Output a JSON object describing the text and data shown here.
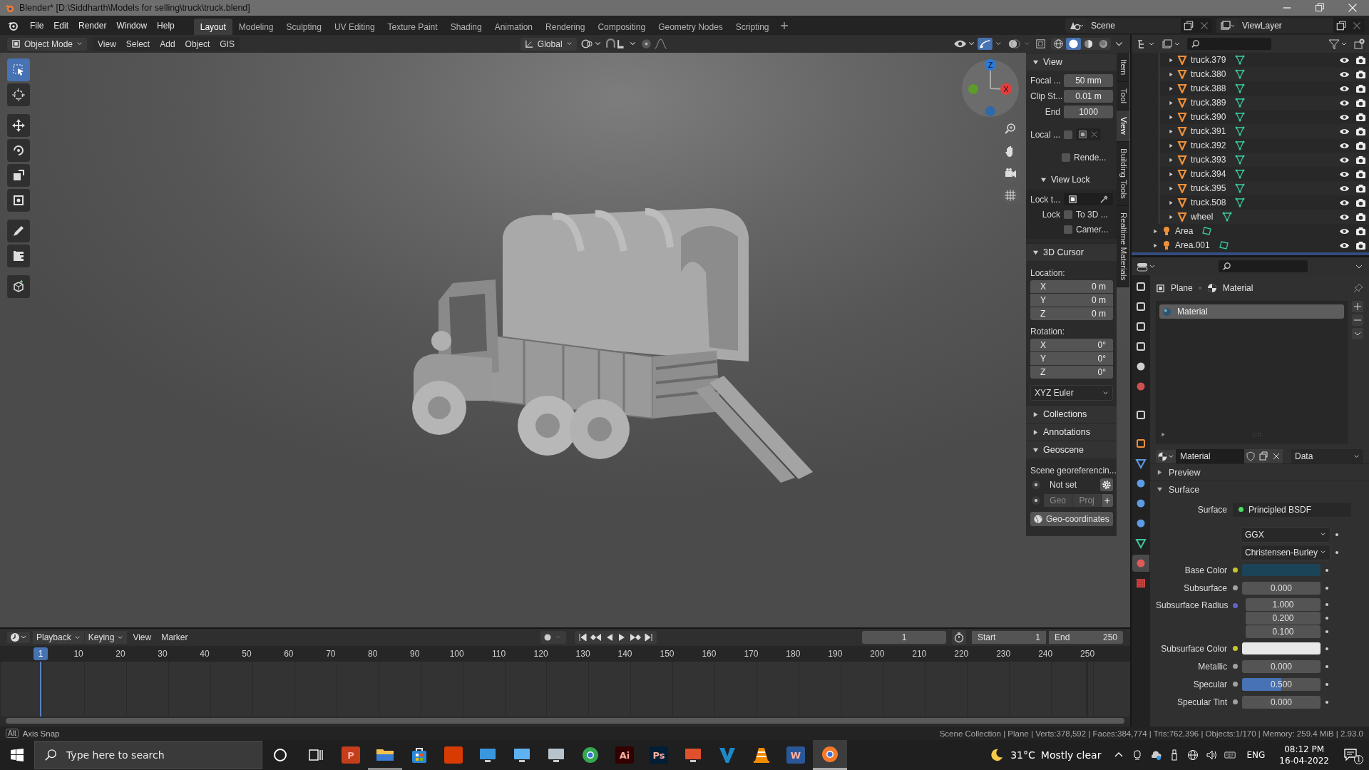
{
  "window": {
    "title": "Blender* [D:\\Siddharth\\Models for selling\\truck\\truck.blend]"
  },
  "menu": [
    "File",
    "Edit",
    "Render",
    "Window",
    "Help"
  ],
  "workspaces": [
    {
      "label": "Layout",
      "selected": true
    },
    {
      "label": "Modeling",
      "selected": false
    },
    {
      "label": "Sculpting",
      "selected": false
    },
    {
      "label": "UV Editing",
      "selected": false
    },
    {
      "label": "Texture Paint",
      "selected": false
    },
    {
      "label": "Shading",
      "selected": false
    },
    {
      "label": "Animation",
      "selected": false
    },
    {
      "label": "Rendering",
      "selected": false
    },
    {
      "label": "Compositing",
      "selected": false
    },
    {
      "label": "Geometry Nodes",
      "selected": false
    },
    {
      "label": "Scripting",
      "selected": false
    }
  ],
  "scene": "Scene",
  "view_layer": "ViewLayer",
  "viewport_header": {
    "mode": "Object Mode",
    "menus": [
      "View",
      "Select",
      "Add",
      "Object",
      "GIS"
    ],
    "orientation": "Global",
    "shading": [
      {
        "kind": "wireframe",
        "selected": false
      },
      {
        "kind": "solid",
        "selected": true
      },
      {
        "kind": "material",
        "selected": false
      },
      {
        "kind": "rendered",
        "selected": false
      }
    ]
  },
  "tools": [
    {
      "kind": "select",
      "selected": true
    },
    {
      "kind": "cursor",
      "selected": false
    },
    {
      "kind": "move",
      "selected": false
    },
    {
      "kind": "rotate",
      "selected": false
    },
    {
      "kind": "scale",
      "selected": false
    },
    {
      "kind": "transform",
      "selected": false
    },
    {
      "kind": "annotate",
      "selected": false
    },
    {
      "kind": "measure",
      "selected": false
    },
    {
      "kind": "add-cube",
      "selected": false
    }
  ],
  "gizmo": {
    "z": "Z",
    "x": "X"
  },
  "sidebar": {
    "tabs": [
      {
        "label": "Item",
        "selected": false
      },
      {
        "label": "Tool",
        "selected": false
      },
      {
        "label": "View",
        "selected": true
      },
      {
        "label": "Building Tools",
        "selected": false
      },
      {
        "label": "Realtime Materials",
        "selected": false
      }
    ],
    "view": {
      "title": "View",
      "expanded": true,
      "fields": [
        {
          "label": "Focal ...",
          "value": "50 mm"
        },
        {
          "label": "Clip St...",
          "value": "0.01 m"
        },
        {
          "label": "End",
          "value": "1000"
        }
      ],
      "local_label": "Local ...",
      "local_checked": false,
      "render_label": "Rende...",
      "render_checked": false,
      "lock": {
        "title": "View Lock",
        "expanded": true,
        "lock_to_label": "Lock t...",
        "lock_label": "Lock",
        "options": [
          {
            "label": "To 3D ...",
            "checked": false
          },
          {
            "label": "Camer...",
            "checked": false
          }
        ]
      }
    },
    "cursor": {
      "title": "3D Cursor",
      "expanded": true,
      "location_label": "Location:",
      "location": [
        {
          "axis": "X",
          "value": "0 m"
        },
        {
          "axis": "Y",
          "value": "0 m"
        },
        {
          "axis": "Z",
          "value": "0 m"
        }
      ],
      "rotation_label": "Rotation:",
      "rotation": [
        {
          "axis": "X",
          "value": "0°"
        },
        {
          "axis": "Y",
          "value": "0°"
        },
        {
          "axis": "Z",
          "value": "0°"
        }
      ],
      "rotation_mode": "XYZ Euler"
    },
    "panels": [
      {
        "title": "Collections",
        "expanded": false
      },
      {
        "title": "Annotations",
        "expanded": false
      }
    ],
    "geoscene": {
      "title": "Geoscene",
      "expanded": true,
      "label": "Scene georeferencin...",
      "crs": "Not set",
      "crs_selected": true,
      "geoproj_selected": true,
      "geo": "Geo",
      "proj": "Proj",
      "add": "+",
      "button": "Geo-coordinates"
    }
  },
  "outliner": {
    "items": [
      {
        "children": [
          {
            "name": "truck.379",
            "kind": "mesh",
            "expanded": false,
            "selected": false
          },
          {
            "name": "truck.380",
            "kind": "mesh",
            "expanded": false,
            "selected": false
          },
          {
            "name": "truck.388",
            "kind": "mesh",
            "expanded": false,
            "selected": false
          },
          {
            "name": "truck.389",
            "kind": "mesh",
            "expanded": false,
            "selected": false
          },
          {
            "name": "truck.390",
            "kind": "mesh",
            "expanded": false,
            "selected": false
          },
          {
            "name": "truck.391",
            "kind": "mesh",
            "expanded": false,
            "selected": false
          },
          {
            "name": "truck.392",
            "kind": "mesh",
            "expanded": false,
            "selected": false
          },
          {
            "name": "truck.393",
            "kind": "mesh",
            "expanded": false,
            "selected": false
          },
          {
            "name": "truck.394",
            "kind": "mesh",
            "expanded": false,
            "selected": false
          },
          {
            "name": "truck.395",
            "kind": "mesh",
            "expanded": false,
            "selected": false
          },
          {
            "name": "truck.508",
            "kind": "mesh",
            "expanded": false,
            "selected": false
          },
          {
            "name": "wheel",
            "kind": "mesh",
            "expanded": false,
            "selected": false
          }
        ]
      },
      {
        "name": "Area",
        "kind": "light",
        "expanded": false,
        "selected": false
      },
      {
        "name": "Area.001",
        "kind": "light",
        "expanded": false,
        "selected": false
      },
      {
        "selected": true
      }
    ]
  },
  "properties": {
    "tabs": [
      {
        "kind": "tool",
        "selected": false
      },
      {
        "kind": "render",
        "selected": false
      },
      {
        "kind": "output",
        "selected": false
      },
      {
        "kind": "view-layer",
        "selected": false
      },
      {
        "kind": "scene",
        "selected": false
      },
      {
        "kind": "world",
        "selected": false
      },
      {
        "kind": "collection",
        "selected": false
      },
      {
        "kind": "object",
        "selected": false
      },
      {
        "kind": "modifier",
        "selected": false
      },
      {
        "kind": "particles",
        "selected": false
      },
      {
        "kind": "physics",
        "selected": false
      },
      {
        "kind": "constraints",
        "selected": false
      },
      {
        "kind": "data",
        "selected": false
      },
      {
        "kind": "material",
        "selected": true
      },
      {
        "kind": "texture",
        "selected": false
      }
    ],
    "breadcrumb": [
      "Plane",
      "Material"
    ],
    "slots": [
      {
        "name": "Material",
        "selected": true
      }
    ],
    "material": "Material",
    "link": "Data",
    "panels": [
      {
        "title": "Preview",
        "expanded": false
      },
      {
        "title": "Surface",
        "expanded": true
      }
    ],
    "surface": {
      "label": "Surface",
      "value": "Principled BSDF"
    },
    "distribution": "GGX",
    "subsurface_method": "Christensen-Burley",
    "rows": [
      {
        "kind": "color",
        "label": "Base Color",
        "color": "#1b4458"
      },
      {
        "kind": "number",
        "label": "Subsurface",
        "value": "0.000"
      },
      {
        "kind": "vector",
        "label": "Subsurface Radius",
        "values": [
          "1.000",
          "0.200",
          "0.100"
        ]
      },
      {
        "kind": "color",
        "label": "Subsurface Color",
        "color": "#e8e8e8"
      },
      {
        "kind": "number",
        "label": "Metallic",
        "value": "0.000"
      },
      {
        "kind": "slider",
        "label": "Specular",
        "value": "0.500",
        "level": 0.5
      },
      {
        "kind": "number",
        "label": "Specular Tint",
        "value": "0.000"
      }
    ]
  },
  "timeline": {
    "menus": [
      {
        "label": "Playback",
        "kind": "dropdown"
      },
      {
        "label": "Keying",
        "kind": "dropdown"
      },
      {
        "label": "View",
        "kind": "menu"
      },
      {
        "label": "Marker",
        "kind": "menu"
      }
    ],
    "current": "1",
    "start_label": "Start",
    "start": "1",
    "end_label": "End",
    "end": "250",
    "ruler": [
      {
        "label": "1",
        "selected": true
      },
      {
        "label": "10",
        "selected": false
      },
      {
        "label": "20",
        "selected": false
      },
      {
        "label": "30",
        "selected": false
      },
      {
        "label": "40",
        "selected": false
      },
      {
        "label": "50",
        "selected": false
      },
      {
        "label": "60",
        "selected": false
      },
      {
        "label": "70",
        "selected": false
      },
      {
        "label": "80",
        "selected": false
      },
      {
        "label": "90",
        "selected": false
      },
      {
        "label": "100",
        "selected": false
      },
      {
        "label": "110",
        "selected": false
      },
      {
        "label": "120",
        "selected": false
      },
      {
        "label": "130",
        "selected": false
      },
      {
        "label": "140",
        "selected": false
      },
      {
        "label": "150",
        "selected": false
      },
      {
        "label": "160",
        "selected": false
      },
      {
        "label": "170",
        "selected": false
      },
      {
        "label": "180",
        "selected": false
      },
      {
        "label": "190",
        "selected": false
      },
      {
        "label": "200",
        "selected": false
      },
      {
        "label": "210",
        "selected": false
      },
      {
        "label": "220",
        "selected": false
      },
      {
        "label": "230",
        "selected": false
      },
      {
        "label": "240",
        "selected": false
      },
      {
        "label": "250",
        "selected": false
      }
    ]
  },
  "status": {
    "key": "Alt",
    "hint": "Axis Snap",
    "stats": "Scene Collection | Plane | Verts:378,592 | Faces:384,774 | Tris:762,396 | Objects:1/170 | Memory: 259.4 MiB | 2.93.0"
  },
  "taskbar": {
    "placeholder": "Type here to search",
    "apps": [
      {
        "kind": "tile",
        "label": "P",
        "color": "#c43e1c",
        "running": false,
        "selected": false
      },
      {
        "kind": "folder",
        "color": "#f2c14e",
        "running": true,
        "selected": false
      },
      {
        "kind": "bag",
        "color": "#2b88d8",
        "running": false,
        "selected": false
      },
      {
        "kind": "tile",
        "color": "#d83b01",
        "running": false,
        "selected": false
      },
      {
        "kind": "screen",
        "color": "#3a96dd",
        "running": false,
        "selected": false
      },
      {
        "kind": "screen",
        "color": "#5fb2f0",
        "running": false,
        "selected": false
      },
      {
        "kind": "screen",
        "color": "#b8c4cc",
        "running": false,
        "selected": false
      },
      {
        "kind": "ring",
        "color": "#34a853",
        "running": false,
        "selected": false
      },
      {
        "kind": "tile",
        "label": "Ai",
        "color": "#330000",
        "running": false,
        "selected": false
      },
      {
        "kind": "tile",
        "label": "Ps",
        "color": "#001e36",
        "running": false,
        "selected": false
      },
      {
        "kind": "screen",
        "color": "#e0502d",
        "running": false,
        "selected": false
      },
      {
        "kind": "vee",
        "color": "#1e88c8",
        "running": false,
        "selected": false
      },
      {
        "kind": "cone",
        "color": "#f08a00",
        "running": false,
        "selected": false
      },
      {
        "kind": "tile",
        "label": "W",
        "color": "#2b579a",
        "running": false,
        "selected": false
      },
      {
        "kind": "ring",
        "color": "#f5792a",
        "running": true,
        "selected": true
      }
    ],
    "temperature": "31°C",
    "weather": "Mostly clear",
    "language": "ENG",
    "time": "08:12 PM",
    "date": "16-04-2022",
    "notifications": "1"
  }
}
